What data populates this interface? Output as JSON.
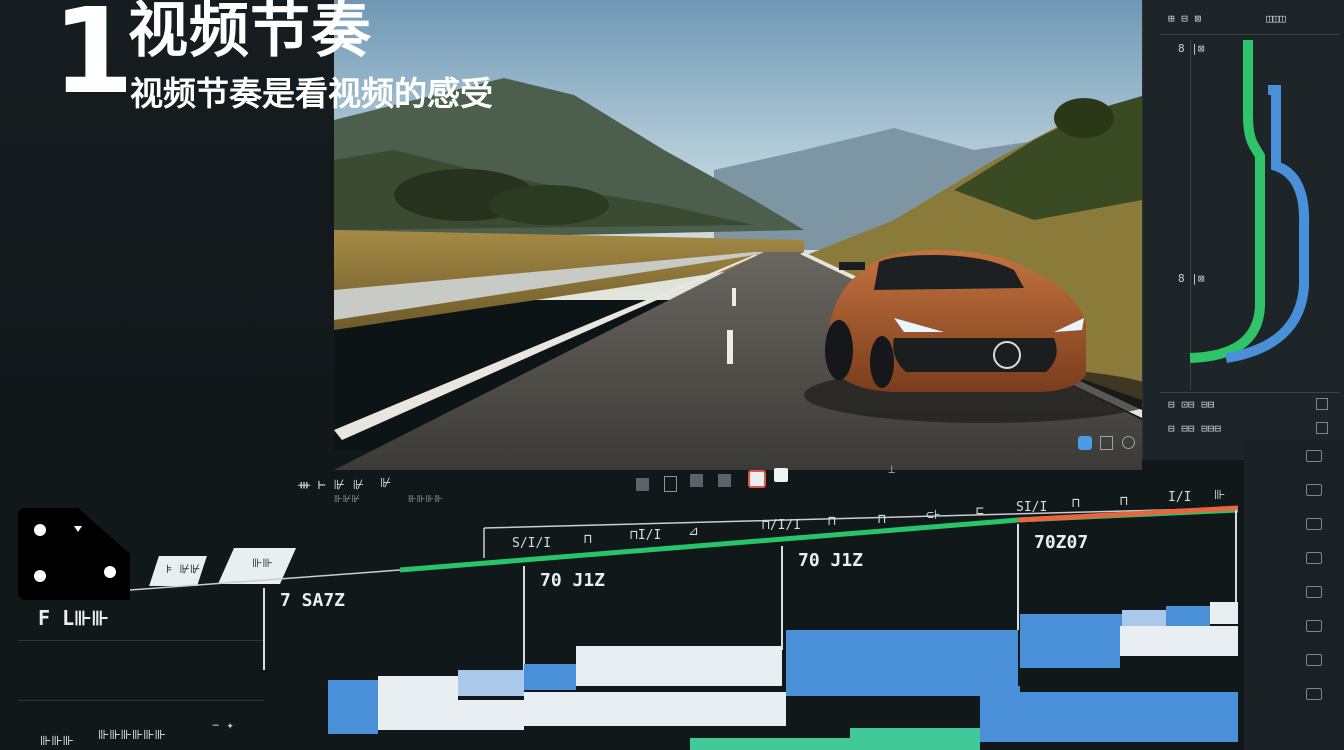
{
  "hero": {
    "number": "1",
    "title": "视频节奏",
    "subtitle": "视频节奏是看视频的感受"
  },
  "right_panel": {
    "header_left": "⊞ ⊟ ⊠",
    "header_right": "◫◫◫",
    "label_top": "8 |⊠",
    "label_mid": "8 |⊠",
    "row1": "⊟ ⊡⊟ ⊟⊟",
    "row2": "⊟ ⊟⊟ ⊟⊟⊟",
    "preview_icons": [
      "layout-icon",
      "compare-icon",
      "eye-icon"
    ]
  },
  "transport": {
    "label_left": "ᚒ ⊢ ⊮ ⊮",
    "label_left_sub": "⊪⊮⊮",
    "label_right": "⊮",
    "label_right_sub": "⊪⊪⊪⊪",
    "buttons": [
      "prev-button",
      "play-button",
      "next-button",
      "record-button",
      "stop-button"
    ]
  },
  "timeline": {
    "tags": [
      "⊧ ⊮⊮",
      "⊪⊪"
    ],
    "track_label": "F L⊪⊪",
    "bottom_label_left": "⊪⊪⊪",
    "bottom_label_mid": "⊪⊪⊪⊪⊪⊪",
    "bottom_controls": "− ✦",
    "ruler": [
      "S/I/I",
      "⊓",
      "⊓I/I",
      "⊿",
      "⊓/I/I",
      "⊓",
      "⊓",
      "⊂⊦",
      "⊏",
      "SI/I",
      "⊓",
      "⊓",
      "I/I",
      "⊪"
    ],
    "markers": [
      "7 SA7Z",
      "70 J1Z",
      "70 J1Z",
      "70Z07"
    ],
    "accent_green": "#27c46a",
    "accent_orange": "#e8663e",
    "clip_blue": "#4a90d9",
    "clip_white": "#e8eef2",
    "clip_light_blue": "#a9c8ea",
    "clip_teal": "#42c99a"
  },
  "side_list": [
    "▭",
    "▭",
    "▭",
    "▭",
    "▭",
    "▭",
    "▭",
    "▭"
  ]
}
